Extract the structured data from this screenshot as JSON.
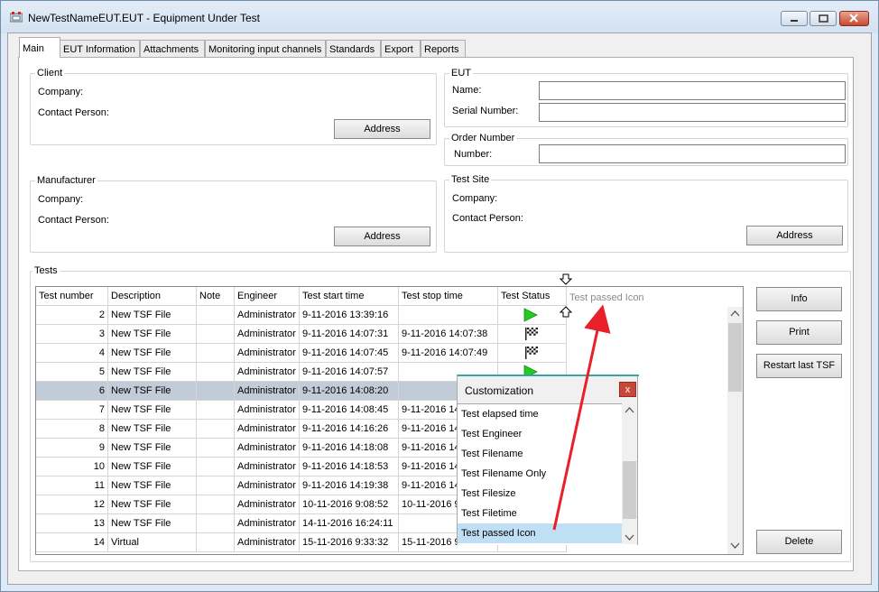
{
  "window": {
    "title": "NewTestNameEUT.EUT - Equipment Under Test"
  },
  "tabs": [
    {
      "label": "Main",
      "active": true
    },
    {
      "label": "EUT Information",
      "active": false
    },
    {
      "label": "Attachments",
      "active": false
    },
    {
      "label": "Monitoring input channels",
      "active": false
    },
    {
      "label": "Standards",
      "active": false
    },
    {
      "label": "Export",
      "active": false
    },
    {
      "label": "Reports",
      "active": false
    }
  ],
  "client": {
    "title": "Client",
    "company_label": "Company:",
    "contact_label": "Contact Person:",
    "address_button": "Address"
  },
  "manufacturer": {
    "title": "Manufacturer",
    "company_label": "Company:",
    "contact_label": "Contact Person:",
    "address_button": "Address"
  },
  "eut": {
    "title": "EUT",
    "name_label": "Name:",
    "name_value": "",
    "serial_label": "Serial Number:",
    "serial_value": ""
  },
  "order": {
    "title": "Order Number",
    "number_label": "Number:",
    "number_value": ""
  },
  "test_site": {
    "title": "Test Site",
    "company_label": "Company:",
    "contact_label": "Contact Person:",
    "address_button": "Address"
  },
  "tests": {
    "title": "Tests",
    "columns": [
      "Test number",
      "Description",
      "Note",
      "Engineer",
      "Test start time",
      "Test stop time",
      "Test Status"
    ],
    "drop_hint": "Test passed Icon",
    "rows": [
      {
        "number": "2",
        "description": "New TSF File",
        "note": "",
        "engineer": "Administrator",
        "start": "9-11-2016 13:39:16",
        "stop": "",
        "status": "passed"
      },
      {
        "number": "3",
        "description": "New TSF File",
        "note": "",
        "engineer": "Administrator",
        "start": "9-11-2016 14:07:31",
        "stop": "9-11-2016 14:07:38",
        "status": "finished"
      },
      {
        "number": "4",
        "description": "New TSF File",
        "note": "",
        "engineer": "Administrator",
        "start": "9-11-2016 14:07:45",
        "stop": "9-11-2016 14:07:49",
        "status": "finished"
      },
      {
        "number": "5",
        "description": "New TSF File",
        "note": "",
        "engineer": "Administrator",
        "start": "9-11-2016 14:07:57",
        "stop": "",
        "status": "passed"
      },
      {
        "number": "6",
        "description": "New TSF File",
        "note": "",
        "engineer": "Administrator",
        "start": "9-11-2016 14:08:20",
        "stop": "",
        "status": "",
        "selected": true
      },
      {
        "number": "7",
        "description": "New TSF File",
        "note": "",
        "engineer": "Administrator",
        "start": "9-11-2016 14:08:45",
        "stop": "9-11-2016 14",
        "status": ""
      },
      {
        "number": "8",
        "description": "New TSF File",
        "note": "",
        "engineer": "Administrator",
        "start": "9-11-2016 14:16:26",
        "stop": "9-11-2016 14",
        "status": ""
      },
      {
        "number": "9",
        "description": "New TSF File",
        "note": "",
        "engineer": "Administrator",
        "start": "9-11-2016 14:18:08",
        "stop": "9-11-2016 14",
        "status": ""
      },
      {
        "number": "10",
        "description": "New TSF File",
        "note": "",
        "engineer": "Administrator",
        "start": "9-11-2016 14:18:53",
        "stop": "9-11-2016 14",
        "status": ""
      },
      {
        "number": "11",
        "description": "New TSF File",
        "note": "",
        "engineer": "Administrator",
        "start": "9-11-2016 14:19:38",
        "stop": "9-11-2016 14",
        "status": ""
      },
      {
        "number": "12",
        "description": "New TSF File",
        "note": "",
        "engineer": "Administrator",
        "start": "10-11-2016 9:08:52",
        "stop": "10-11-2016 9",
        "status": ""
      },
      {
        "number": "13",
        "description": "New TSF File",
        "note": "",
        "engineer": "Administrator",
        "start": "14-11-2016 16:24:11",
        "stop": "",
        "status": ""
      },
      {
        "number": "14",
        "description": "Virtual",
        "note": "",
        "engineer": "Administrator",
        "start": "15-11-2016 9:33:32",
        "stop": "15-11-2016 9",
        "status": ""
      }
    ]
  },
  "side_buttons": {
    "info": "Info",
    "print": "Print",
    "restart": "Restart last TSF",
    "delete": "Delete"
  },
  "customization": {
    "title": "Customization",
    "close_label": "x",
    "items": [
      "Test elapsed time",
      "Test Engineer",
      "Test Filename",
      "Test Filename Only",
      "Test Filesize",
      "Test Filetime",
      "Test passed Icon"
    ],
    "selected_item": "Test passed Icon"
  },
  "colors": {
    "accent_arrow": "#e8202a",
    "selection": "#c2ccd8",
    "list_selection": "#bfdff5",
    "passed_icon": "#22cc22"
  },
  "icons": {
    "app": "app-icon",
    "passed": "green-triangle-icon",
    "finished": "checkered-flag-icon",
    "drag_target": "up-arrow-icon"
  }
}
